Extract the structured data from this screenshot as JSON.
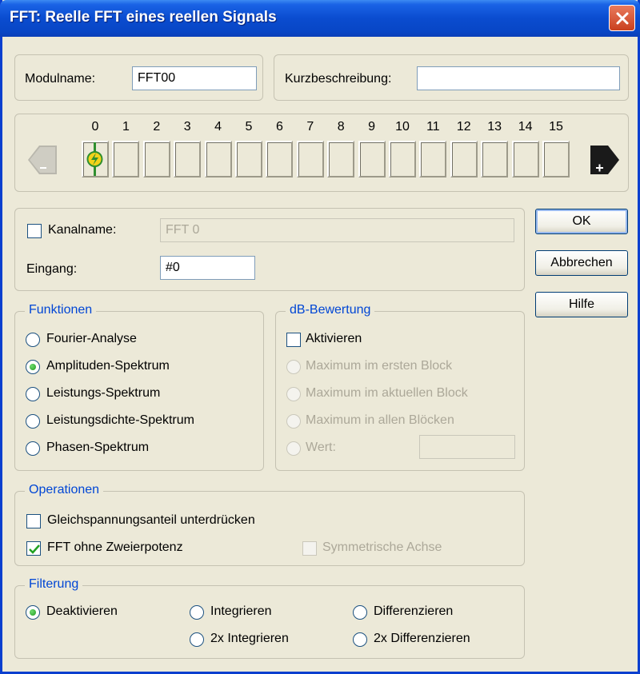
{
  "window": {
    "title": "FFT: Reelle FFT eines reellen Signals"
  },
  "module": {
    "name_label": "Modulname:",
    "name_value": "FFT00",
    "desc_label": "Kurzbeschreibung:",
    "desc_value": ""
  },
  "channels": {
    "numbers": [
      "0",
      "1",
      "2",
      "3",
      "4",
      "5",
      "6",
      "7",
      "8",
      "9",
      "10",
      "11",
      "12",
      "13",
      "14",
      "15"
    ],
    "prev_icon": "minus-arrow-left-icon",
    "next_icon": "plus-arrow-right-icon",
    "active_icon": "lightning-icon"
  },
  "channel": {
    "name_label": "Kanalname:",
    "name_value": "FFT 0",
    "input_label": "Eingang:",
    "input_value": "#0"
  },
  "buttons": {
    "ok": "OK",
    "cancel": "Abbrechen",
    "help": "Hilfe"
  },
  "funktionen": {
    "legend": "Funktionen",
    "options": [
      "Fourier-Analyse",
      "Amplituden-Spektrum",
      "Leistungs-Spektrum",
      "Leistungsdichte-Spektrum",
      "Phasen-Spektrum"
    ],
    "selected": "Amplituden-Spektrum"
  },
  "db": {
    "legend": "dB-Bewertung",
    "activate": "Aktivieren",
    "options": [
      "Maximum im ersten Block",
      "Maximum im aktuellen Block",
      "Maximum in allen Blöcken",
      "Wert:"
    ],
    "value": ""
  },
  "operationen": {
    "legend": "Operationen",
    "dc": "Gleichspannungsanteil unterdrücken",
    "fft_no_pow2": "FFT ohne Zweierpotenz",
    "symmetric": "Symmetrische Achse"
  },
  "filterung": {
    "legend": "Filterung",
    "options": [
      "Deaktivieren",
      "Integrieren",
      "Differenzieren",
      "2x Integrieren",
      "2x Differenzieren"
    ],
    "selected": "Deaktivieren"
  },
  "colors": {
    "title_bar": "#0a4ccf",
    "legend_text": "#0046d5",
    "close_button": "#d4492a",
    "radio_dot": "#1f9a1f",
    "check_mark": "#21a121"
  }
}
